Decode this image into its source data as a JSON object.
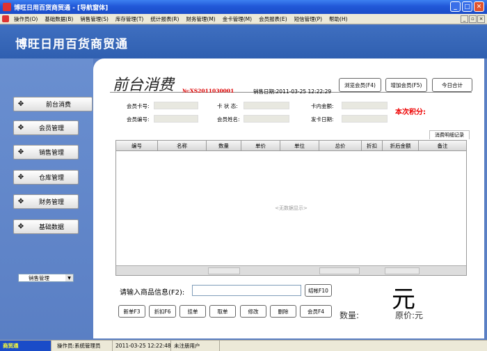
{
  "window": {
    "title": "博旺日用百货商贸通 - [导航窗体]",
    "min": "_",
    "max": "□",
    "close": "✕"
  },
  "menu": [
    "操作员(O)",
    "基础数据(B)",
    "销售管理(S)",
    "库存管理(T)",
    "统计报表(R)",
    "财务管理(M)",
    "金卡管理(M)",
    "会员报表(E)",
    "短信管理(P)",
    "帮助(H)"
  ],
  "mdi_buttons": {
    "min": "_",
    "restore": "▫",
    "close": "×"
  },
  "banner": {
    "title": "博旺日用百货商贸通"
  },
  "sidebar": {
    "items": [
      {
        "label": "前台消费",
        "active": true
      },
      {
        "label": "会员管理",
        "active": false
      },
      {
        "label": "销售管理",
        "active": false
      },
      {
        "label": "仓库管理",
        "active": false
      },
      {
        "label": "财务管理",
        "active": false
      },
      {
        "label": "基础数据",
        "active": false
      }
    ],
    "select": {
      "value": "销售管理",
      "arrow": "▼"
    }
  },
  "main": {
    "heading": "前台消费",
    "order_no": "№:XS2011030001",
    "sale_date_label": "销售日期:",
    "sale_date": "2011-03-25 12:22:29",
    "buttons": {
      "browse_member": "浏览会员(F4)",
      "add_member": "增加会员(F5)",
      "today_total": "今日合计"
    },
    "labels": {
      "card_no": "会员卡号:",
      "card_status": "卡 状 态:",
      "card_balance": "卡内金额:",
      "member_no": "会员编号:",
      "member_name": "会员姓名:",
      "issue_date": "发卡日期:",
      "points": "本次积分:"
    },
    "tab": "消费明细记录",
    "grid": {
      "columns": [
        "编号",
        "名称",
        "数量",
        "单价",
        "单位",
        "总价",
        "折扣",
        "折后金额",
        "备注"
      ],
      "empty_text": "<无数据显示>"
    },
    "input_label": "请输入商品信息(F2):",
    "input_value": "",
    "checkout": "结帐F10",
    "actions": [
      "新单F3",
      "折扣F6",
      "挂单",
      "取单",
      "修改",
      "删除",
      "会员F4"
    ],
    "currency": "元",
    "qty_label": "数量:",
    "price_label": "原价:元"
  },
  "status": {
    "app": "商贸通",
    "operator": "操作员:系统管理员",
    "datetime": "2011-03-25 12:22:48",
    "registration": "未注册用户"
  },
  "colors": {
    "titlebar": "#2158d8",
    "banner": "#3566b8",
    "sidebar": "#5a7fc4",
    "accent_red": "#dd0000"
  }
}
